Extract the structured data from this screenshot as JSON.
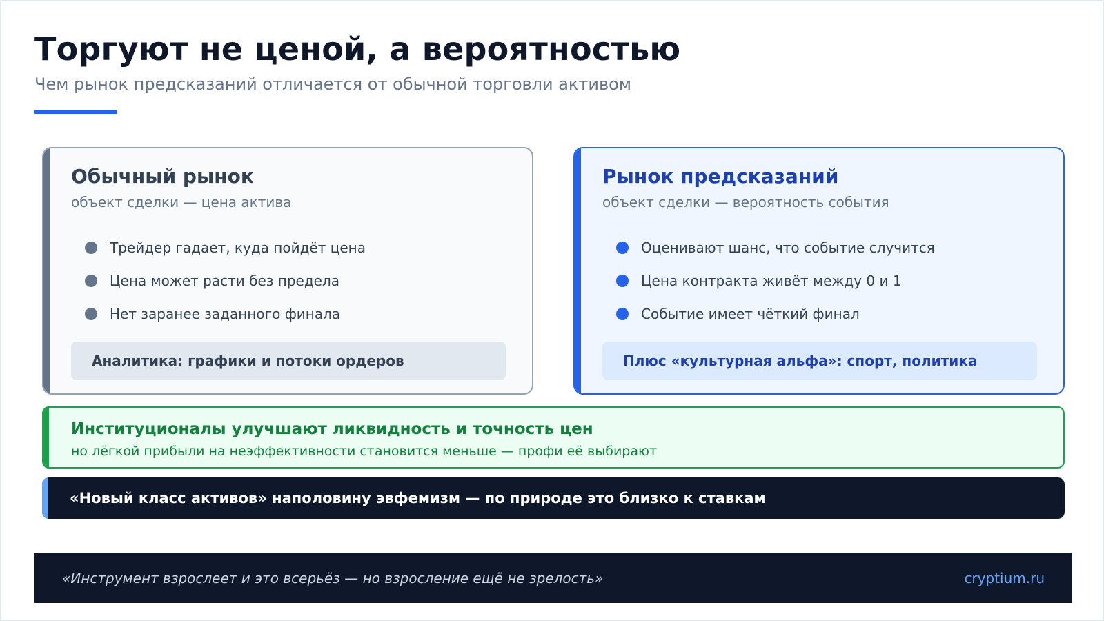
{
  "header": {
    "title": "Торгуют не ценой, а вероятностью",
    "subtitle": "Чем рынок предсказаний отличается от обычной торговли активом"
  },
  "cards": {
    "left": {
      "title": "Обычный рынок",
      "subtitle": "объект сделки — цена актива",
      "bullets": [
        "Трейдер гадает, куда пойдёт цена",
        "Цена может расти без предела",
        "Нет заранее заданного финала"
      ],
      "note": "Аналитика: графики и потоки ордеров"
    },
    "right": {
      "title": "Рынок предсказаний",
      "subtitle": "объект сделки — вероятность события",
      "bullets": [
        "Оценивают шанс, что событие случится",
        "Цена контракта живёт между 0 и 1",
        "Событие имеет чёткий финал"
      ],
      "note": "Плюс «культурная альфа»: спорт, политика"
    }
  },
  "institutions": {
    "title": "Институционалы улучшают ликвидность и точность цен",
    "subtitle": "но лёгкой прибыли на неэффективности становится меньше — профи её выбирают"
  },
  "callout": {
    "text": "«Новый класс активов» наполовину эвфемизм — по природе это близко к ставкам"
  },
  "footer": {
    "quote": "«Инструмент взрослеет и это всерьёз — но взросление ещё не зрелость»",
    "site": "cryptium.ru"
  },
  "colors": {
    "accent": "#2563eb",
    "neutral": "#64748b",
    "positive": "#16a34a",
    "dark": "#0f172a"
  }
}
